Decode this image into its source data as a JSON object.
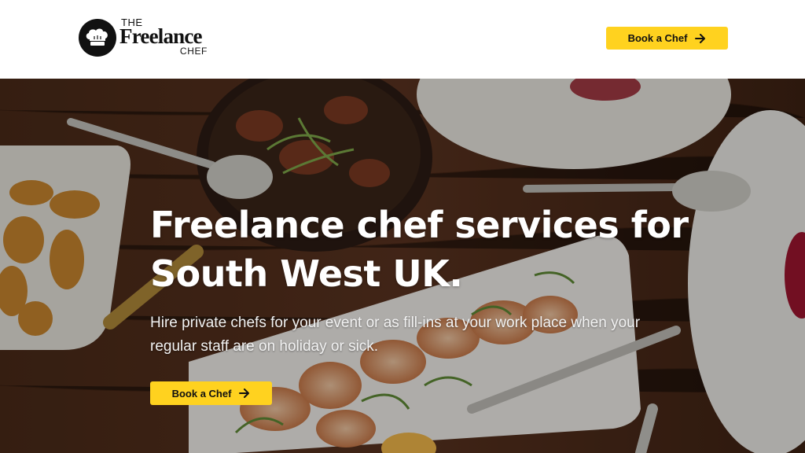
{
  "header": {
    "logo": {
      "line1": "THE",
      "line2": "Freelance",
      "line3": "CHEF",
      "icon": "chef-hat-icon"
    },
    "cta_label": "Book a Chef",
    "cta_icon": "arrow-right-icon"
  },
  "hero": {
    "title_line1": "Freelance chef services for",
    "title_line2": "South West UK.",
    "subtitle_line1": "Hire private chefs for your event or as fill-ins at your work place when your",
    "subtitle_line2": "regular staff are on holiday or sick.",
    "cta_label": "Book a Chef",
    "cta_icon": "arrow-right-icon"
  },
  "colors": {
    "accent": "#ffd21f",
    "header_bg": "#ffffff",
    "text_dark": "#111111"
  }
}
